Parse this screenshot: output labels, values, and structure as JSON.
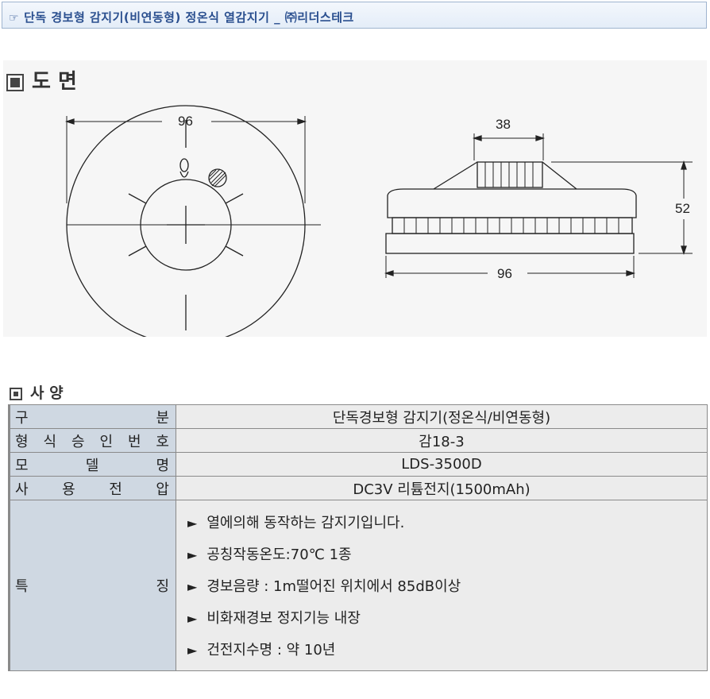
{
  "header": {
    "icon": "pointing-hand-icon",
    "title": "단독 경보형 감지기(비연동형) 정온식 열감지기 _ ㈜리더스테크"
  },
  "drawing": {
    "heading": "도 면",
    "top_view_width": "96",
    "side_view_top_width": "38",
    "side_view_height": "52",
    "side_view_bottom_width": "96"
  },
  "specs": {
    "heading": "사 양",
    "rows": [
      {
        "label_chars": [
          "구",
          "분"
        ],
        "value": "단독경보형 감지기(정온식/비연동형)"
      },
      {
        "label_chars": [
          "형",
          "식",
          "승",
          "인",
          "번",
          "호"
        ],
        "value": "감18-3"
      },
      {
        "label_chars": [
          "모",
          "델",
          "명"
        ],
        "value": "LDS-3500D"
      },
      {
        "label_chars": [
          "사",
          "용",
          "전",
          "압"
        ],
        "value": "DC3V 리튬전지(1500mAh)"
      }
    ],
    "features_label_chars": [
      "특",
      "징"
    ],
    "feature_bullet": "►",
    "features": [
      "열에의해 동작하는 감지기입니다.",
      "공칭작동온도:70℃ 1종",
      "경보음량 : 1m떨어진 위치에서 85dB이상",
      "비화재경보 정지기능 내장",
      "건전지수명 : 약 10년"
    ]
  }
}
